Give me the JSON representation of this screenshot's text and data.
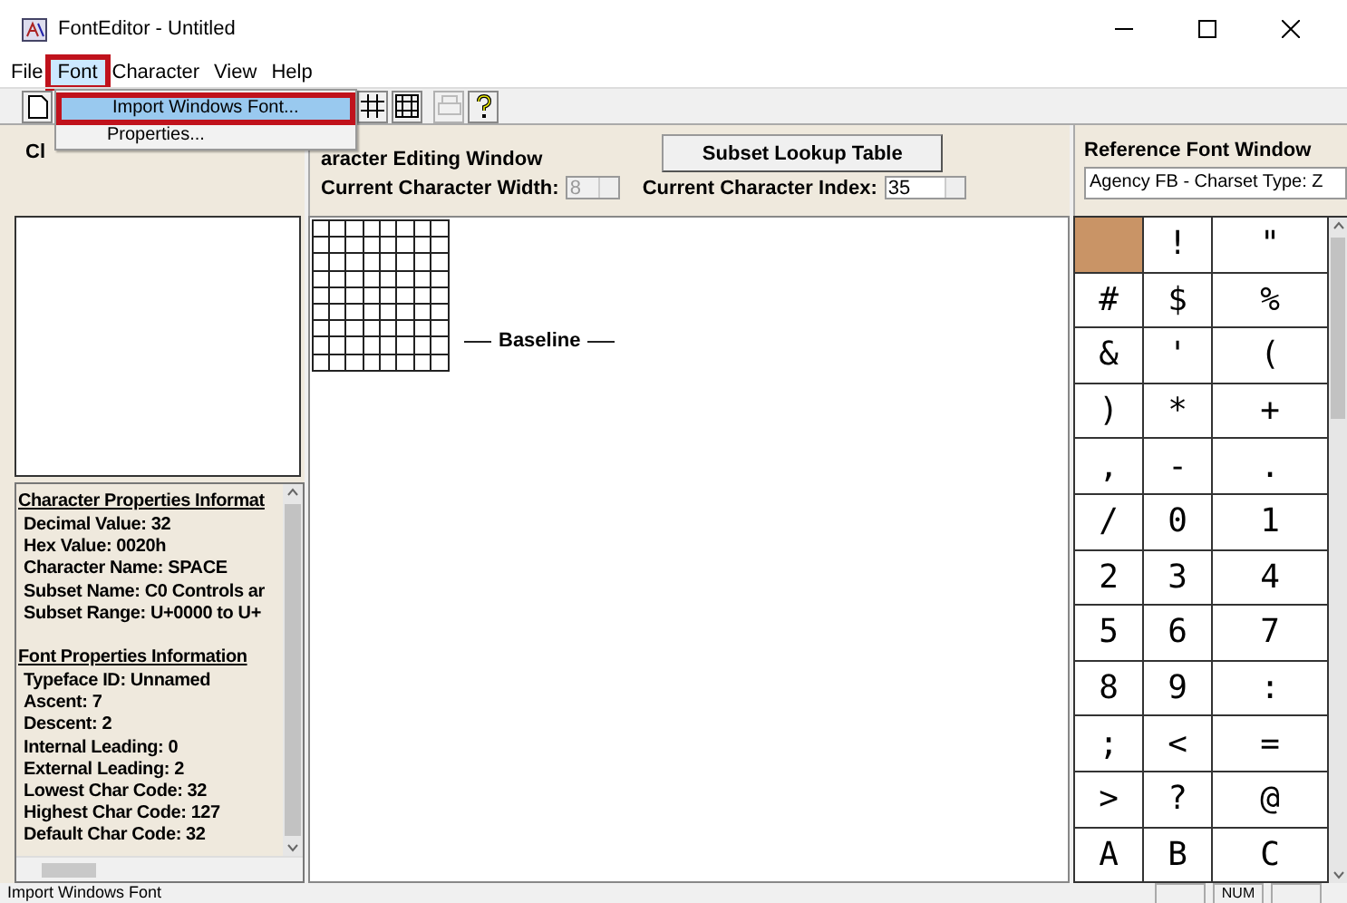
{
  "window": {
    "title": "FontEditor - Untitled"
  },
  "menu": [
    {
      "label": "File",
      "selected": false,
      "annotated": false
    },
    {
      "label": "Font",
      "selected": true,
      "annotated": true
    },
    {
      "label": "Character",
      "selected": false,
      "annotated": false
    },
    {
      "label": "View",
      "selected": false,
      "annotated": false
    },
    {
      "label": "Help",
      "selected": false,
      "annotated": false
    }
  ],
  "dropdown": [
    {
      "label": "Import Windows Font...",
      "selected": true,
      "annotated": true
    },
    {
      "label": "Properties...",
      "selected": false,
      "annotated": false
    }
  ],
  "toolbar": [
    {
      "kind": "new",
      "disabled": false
    },
    {
      "kind": "grid",
      "disabled": false
    },
    {
      "kind": "grid2",
      "disabled": false
    },
    {
      "kind": "print",
      "disabled": true
    },
    {
      "kind": "help",
      "disabled": false
    }
  ],
  "preview_panel": {
    "title": "Cl"
  },
  "info_panel": {
    "sections": [
      {
        "title": "Character Properties Informat",
        "lines": [
          "Decimal Value: 32",
          "Hex Value: 0020h",
          "Character Name: SPACE",
          "Subset Name: C0 Controls ar",
          "Subset Range: U+0000 to U+"
        ]
      },
      {
        "title": "Font Properties Information",
        "lines": [
          "Typeface ID: Unnamed",
          "Ascent: 7",
          "Descent: 2",
          "Internal Leading: 0",
          "External Leading: 2",
          "Lowest Char Code: 32",
          "Highest Char Code: 127",
          "Default Char Code: 32"
        ]
      }
    ]
  },
  "editing_panel": {
    "title": "aracter Editing Window",
    "button": "Subset Lookup Table",
    "width_field": {
      "label": "Current Character Width:",
      "value": "8",
      "disabled": true
    },
    "index_field": {
      "label": "Current Character Index:",
      "value": "35",
      "disabled": false
    },
    "baseline_label": "Baseline"
  },
  "reference_panel": {
    "title": "Reference Font Window",
    "font_select": "Agency FB - Charset Type: Z",
    "chars": [
      {
        "selected": true
      },
      {
        "char": "!",
        "selected": false
      },
      {
        "char": "\"",
        "selected": false
      },
      {
        "char": "#",
        "selected": false
      },
      {
        "char": "$",
        "selected": false
      },
      {
        "char": "%",
        "selected": false
      },
      {
        "char": "&",
        "selected": false
      },
      {
        "char": "'",
        "selected": false
      },
      {
        "char": "(",
        "selected": false
      },
      {
        "char": ")",
        "selected": false
      },
      {
        "char": "*",
        "selected": false
      },
      {
        "char": "+",
        "selected": false
      },
      {
        "char": ",",
        "selected": false
      },
      {
        "char": "-",
        "selected": false
      },
      {
        "char": ".",
        "selected": false
      },
      {
        "char": "/",
        "selected": false
      },
      {
        "char": "0",
        "selected": false
      },
      {
        "char": "1",
        "selected": false
      },
      {
        "char": "2",
        "selected": false
      },
      {
        "char": "3",
        "selected": false
      },
      {
        "char": "4",
        "selected": false
      },
      {
        "char": "5",
        "selected": false
      },
      {
        "char": "6",
        "selected": false
      },
      {
        "char": "7",
        "selected": false
      },
      {
        "char": "8",
        "selected": false
      },
      {
        "char": "9",
        "selected": false
      },
      {
        "char": ":",
        "selected": false
      },
      {
        "char": ";",
        "selected": false
      },
      {
        "char": "<",
        "selected": false
      },
      {
        "char": "=",
        "selected": false
      },
      {
        "char": ">",
        "selected": false
      },
      {
        "char": "?",
        "selected": false
      },
      {
        "char": "@",
        "selected": false
      },
      {
        "char": "A",
        "selected": false
      },
      {
        "char": "B",
        "selected": false
      },
      {
        "char": "C",
        "selected": false
      }
    ]
  },
  "status_bar": {
    "message": "Import Windows Font",
    "indicators": [
      "NUM"
    ]
  }
}
